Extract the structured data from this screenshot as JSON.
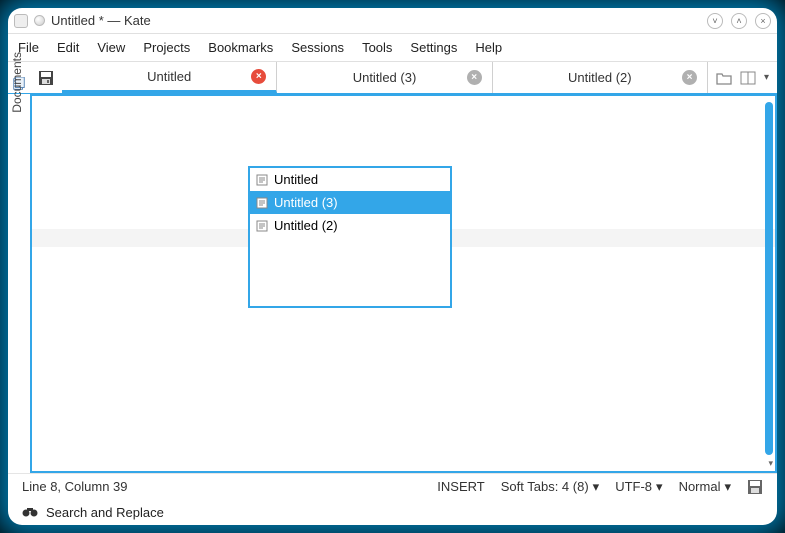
{
  "window": {
    "title": "Untitled * — Kate"
  },
  "menu": {
    "items": [
      "File",
      "Edit",
      "View",
      "Projects",
      "Bookmarks",
      "Sessions",
      "Tools",
      "Settings",
      "Help"
    ]
  },
  "sidebar": {
    "label": "Documents"
  },
  "tabs": {
    "items": [
      {
        "label": "Untitled",
        "active": true,
        "modified": true
      },
      {
        "label": "Untitled (3)",
        "active": false,
        "modified": false
      },
      {
        "label": "Untitled (2)",
        "active": false,
        "modified": false
      }
    ]
  },
  "switcher": {
    "items": [
      {
        "label": "Untitled",
        "selected": false
      },
      {
        "label": "Untitled (3)",
        "selected": true
      },
      {
        "label": "Untitled (2)",
        "selected": false
      }
    ]
  },
  "status": {
    "position": "Line 8, Column 39",
    "mode": "INSERT",
    "tabs": "Soft Tabs: 4 (8)",
    "encoding": "UTF-8",
    "highlight": "Normal"
  },
  "bottom": {
    "label": "Search and Replace"
  },
  "colors": {
    "accent": "#33a6e8"
  }
}
